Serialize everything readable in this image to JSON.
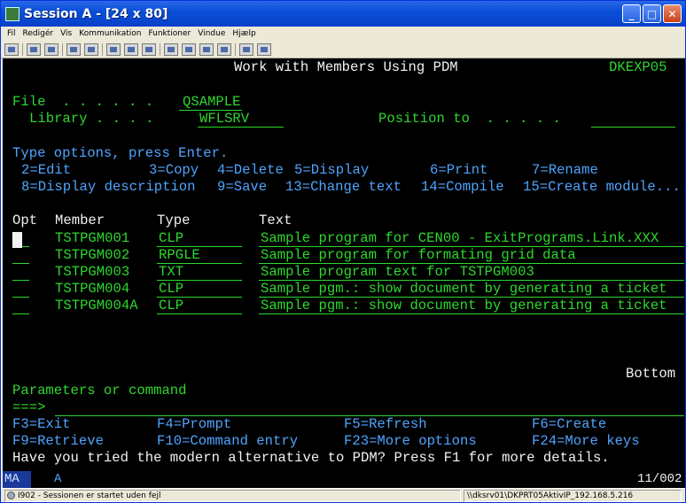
{
  "window": {
    "title": "Session A - [24 x 80]",
    "minimize": "_",
    "maximize": "□",
    "close": "✕"
  },
  "menu": [
    "Fil",
    "Redigér",
    "Vis",
    "Kommunikation",
    "Funktioner",
    "Vindue",
    "Hjælp"
  ],
  "toolbar_icons": [
    "print-icon",
    "copy-icon",
    "paste-icon",
    "send-icon",
    "receive-icon",
    "display-icon",
    "color-icon",
    "map-icon",
    "macro-record-icon",
    "macro-play-icon",
    "macro-stop-icon",
    "clipboard-icon",
    "globe-icon",
    "help-icon"
  ],
  "screen": {
    "title": "Work with Members Using PDM",
    "system": "DKEXP05",
    "file_label": "File  . . . . . .",
    "file_value": "QSAMPLE",
    "library_label": "Library . . . .",
    "library_value": "WFLSRV",
    "position_label": "Position to  . . . . .",
    "position_value": "",
    "instructions": "Type options, press Enter.",
    "options": [
      {
        "text": "2=Edit"
      },
      {
        "text": "3=Copy"
      },
      {
        "text": "4=Delete"
      },
      {
        "text": "5=Display"
      },
      {
        "text": "6=Print"
      },
      {
        "text": "7=Rename"
      },
      {
        "text": "8=Display description"
      },
      {
        "text": "9=Save"
      },
      {
        "text": "13=Change text"
      },
      {
        "text": "14=Compile"
      },
      {
        "text": "15=Create module..."
      }
    ],
    "columns": {
      "opt": "Opt",
      "member": "Member",
      "type": "Type",
      "text": "Text"
    },
    "rows": [
      {
        "member": "TSTPGM001",
        "type": "CLP",
        "text": "Sample program for CEN00 - ExitPrograms.Link.XXX"
      },
      {
        "member": "TSTPGM002",
        "type": "RPGLE",
        "text": "Sample program for formating grid data"
      },
      {
        "member": "TSTPGM003",
        "type": "TXT",
        "text": "Sample program text for TSTPGM003"
      },
      {
        "member": "TSTPGM004",
        "type": "CLP",
        "text": "Sample pgm.: show document by generating a ticket"
      },
      {
        "member": "TSTPGM004A",
        "type": "CLP",
        "text": "Sample pgm.: show document by generating a ticket"
      }
    ],
    "bottom": "Bottom",
    "params_label": "Parameters or command",
    "prompt": "===>",
    "command_value": "",
    "fkeys": [
      "F3=Exit",
      "F4=Prompt",
      "F5=Refresh",
      "F6=Create",
      "F9=Retrieve",
      "F10=Command entry",
      "F23=More options",
      "F24=More keys"
    ],
    "message": "Have you tried the modern alternative to PDM? Press F1 for more details."
  },
  "oia": {
    "mode": "MA",
    "indicator": "A",
    "cursor_pos": "11/002"
  },
  "status": {
    "left": "I902 - Sessionen er startet uden fejl",
    "right": "\\\\dksrv01\\DKPRT05AktivIP_192.168.5.216"
  },
  "colors": {
    "green": "#2ed82e",
    "white": "#f2f2f2",
    "blue": "#4fa4ff",
    "titlebar": "#0a4fd8"
  }
}
